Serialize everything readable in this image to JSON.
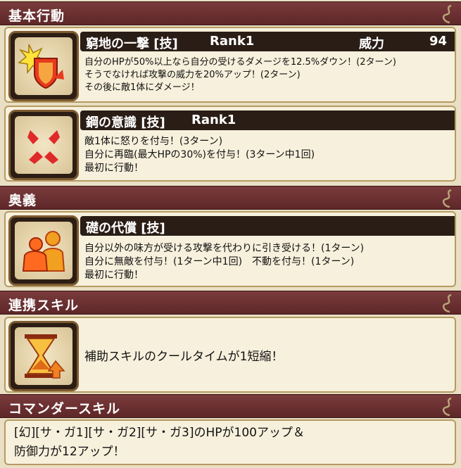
{
  "sections": {
    "basic": "基本行動",
    "ougi": "奥義",
    "link": "連携スキル",
    "commander": "コマンダースキル"
  },
  "skill1": {
    "icon": "crash-shield-icon",
    "name": "窮地の一撃 [技]",
    "rank": "Rank1",
    "power_label": "威力",
    "power_value": "94",
    "lines": [
      "自分のHPが50%以上なら自分の受けるダメージを12.5%ダウン！(2ターン)",
      "そうでなければ攻撃の威力を20%アップ！(2ターン)",
      "その後に敵1体にダメージ！"
    ]
  },
  "skill2": {
    "icon": "anger-mark-icon",
    "name": "鋼の意識 [技]",
    "rank": "Rank1",
    "lines": [
      "敵1体に怒りを付与！(3ターン)",
      "自分に再臨(最大HPの30%)を付与！(3ターン中1回)",
      "最初に行動！"
    ]
  },
  "ougi": {
    "icon": "guard-ally-icon",
    "name": "礎の代償 [技]",
    "lines": [
      "自分以外の味方が受ける攻撃を代わりに引き受ける！(1ターン)",
      "自分に無敵を付与！(1ターン中1回)　不動を付与！(1ターン)",
      "最初に行動！"
    ]
  },
  "link": {
    "icon": "hourglass-up-icon",
    "text": "補助スキルのクールタイムが1短縮！"
  },
  "commander": {
    "lines": [
      "[幻][サ・ガ1][サ・ガ2][サ・ガ3]のHPが100アップ＆",
      "防御力が12アップ！"
    ]
  },
  "colors": {
    "section_bar": "#6b2f30",
    "card_bg": "#f7f0dc",
    "title_bar": "#2a1d16",
    "page_bg": "#e9dfc4"
  }
}
